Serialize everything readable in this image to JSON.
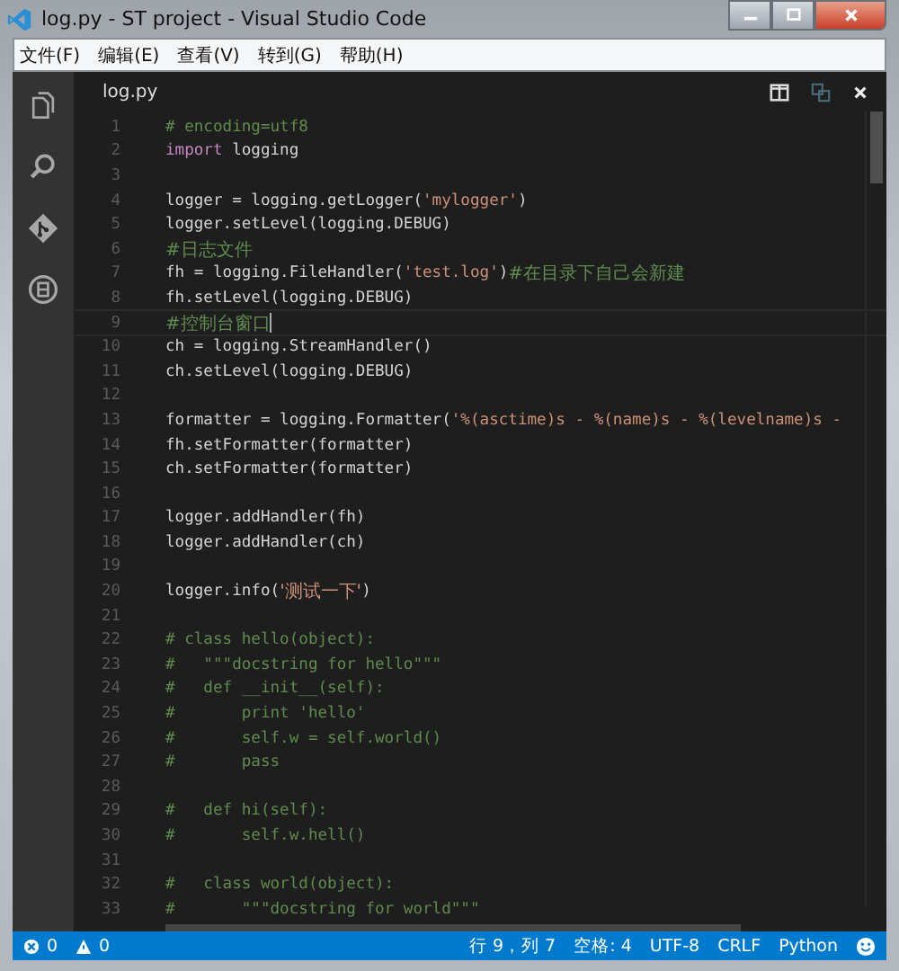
{
  "window": {
    "title": "log.py - ST project - Visual Studio Code"
  },
  "menu": [
    "文件(F)",
    "编辑(E)",
    "查看(V)",
    "转到(G)",
    "帮助(H)"
  ],
  "activity_bar": [
    {
      "kind": "files",
      "selected": false
    },
    {
      "kind": "search",
      "selected": false
    },
    {
      "kind": "git",
      "selected": false
    },
    {
      "kind": "extensions",
      "selected": false
    }
  ],
  "editor": {
    "tab": "log.py",
    "lines": [
      {
        "n": "1",
        "current": false,
        "tokens": [
          {
            "kind": "comment",
            "t": "# encoding=utf8"
          }
        ]
      },
      {
        "n": "2",
        "current": false,
        "tokens": [
          {
            "kind": "keyword",
            "t": "import"
          },
          {
            "kind": "plain",
            "t": " logging"
          }
        ]
      },
      {
        "n": "3",
        "current": false
      },
      {
        "n": "4",
        "current": false,
        "tokens": [
          {
            "kind": "plain",
            "t": "logger = logging.getLogger("
          },
          {
            "kind": "string",
            "t": "'mylogger'"
          },
          {
            "kind": "plain",
            "t": ")"
          }
        ]
      },
      {
        "n": "5",
        "current": false,
        "tokens": [
          {
            "kind": "plain",
            "t": "logger.setLevel(logging.DEBUG)"
          }
        ]
      },
      {
        "n": "6",
        "current": false,
        "tokens": [
          {
            "kind": "comment",
            "t": "#日志文件"
          }
        ]
      },
      {
        "n": "7",
        "current": false,
        "tokens": [
          {
            "kind": "plain",
            "t": "fh = logging.FileHandler("
          },
          {
            "kind": "string",
            "t": "'test.log'"
          },
          {
            "kind": "plain",
            "t": ")"
          },
          {
            "kind": "comment",
            "t": "#在目录下自己会新建"
          }
        ]
      },
      {
        "n": "8",
        "current": false,
        "tokens": [
          {
            "kind": "plain",
            "t": "fh.setLevel(logging.DEBUG)"
          }
        ]
      },
      {
        "n": "9",
        "current": true,
        "tokens": [
          {
            "kind": "comment",
            "t": "#控制台窗口"
          }
        ]
      },
      {
        "n": "10",
        "current": false,
        "tokens": [
          {
            "kind": "plain",
            "t": "ch = logging.StreamHandler()"
          }
        ]
      },
      {
        "n": "11",
        "current": false,
        "tokens": [
          {
            "kind": "plain",
            "t": "ch.setLevel(logging.DEBUG)"
          }
        ]
      },
      {
        "n": "12",
        "current": false
      },
      {
        "n": "13",
        "current": false,
        "tokens": [
          {
            "kind": "plain",
            "t": "formatter = logging.Formatter("
          },
          {
            "kind": "string",
            "t": "'%(asctime)s - %(name)s - %(levelname)s -"
          }
        ]
      },
      {
        "n": "14",
        "current": false,
        "tokens": [
          {
            "kind": "plain",
            "t": "fh.setFormatter(formatter)"
          }
        ]
      },
      {
        "n": "15",
        "current": false,
        "tokens": [
          {
            "kind": "plain",
            "t": "ch.setFormatter(formatter)"
          }
        ]
      },
      {
        "n": "16",
        "current": false
      },
      {
        "n": "17",
        "current": false,
        "tokens": [
          {
            "kind": "plain",
            "t": "logger.addHandler(fh)"
          }
        ]
      },
      {
        "n": "18",
        "current": false,
        "tokens": [
          {
            "kind": "plain",
            "t": "logger.addHandler(ch)"
          }
        ]
      },
      {
        "n": "19",
        "current": false
      },
      {
        "n": "20",
        "current": false,
        "tokens": [
          {
            "kind": "plain",
            "t": "logger.info("
          },
          {
            "kind": "string",
            "t": "'测试一下'"
          },
          {
            "kind": "plain",
            "t": ")"
          }
        ]
      },
      {
        "n": "21",
        "current": false
      },
      {
        "n": "22",
        "current": false,
        "tokens": [
          {
            "kind": "comment",
            "t": "# class hello(object):"
          }
        ]
      },
      {
        "n": "23",
        "current": false,
        "tokens": [
          {
            "kind": "comment",
            "t": "#   \"\"\"docstring for hello\"\"\""
          }
        ]
      },
      {
        "n": "24",
        "current": false,
        "tokens": [
          {
            "kind": "comment",
            "t": "#   def __init__(self):"
          }
        ]
      },
      {
        "n": "25",
        "current": false,
        "tokens": [
          {
            "kind": "comment",
            "t": "#       print 'hello'"
          }
        ]
      },
      {
        "n": "26",
        "current": false,
        "tokens": [
          {
            "kind": "comment",
            "t": "#       self.w = self.world()"
          }
        ]
      },
      {
        "n": "27",
        "current": false,
        "tokens": [
          {
            "kind": "comment",
            "t": "#       pass"
          }
        ]
      },
      {
        "n": "28",
        "current": false
      },
      {
        "n": "29",
        "current": false,
        "tokens": [
          {
            "kind": "comment",
            "t": "#   def hi(self):"
          }
        ]
      },
      {
        "n": "30",
        "current": false,
        "tokens": [
          {
            "kind": "comment",
            "t": "#       self.w.hell()"
          }
        ]
      },
      {
        "n": "31",
        "current": false
      },
      {
        "n": "32",
        "current": false,
        "tokens": [
          {
            "kind": "comment",
            "t": "#   class world(object):"
          }
        ]
      },
      {
        "n": "33",
        "current": false,
        "tokens": [
          {
            "kind": "comment",
            "t": "#       \"\"\"docstring for world\"\"\""
          }
        ]
      }
    ]
  },
  "status_bar": {
    "errors": "0",
    "warnings": "0",
    "position": "行 9，列 7",
    "indent": "空格: 4",
    "encoding": "UTF-8",
    "eol": "CRLF",
    "language": "Python"
  }
}
